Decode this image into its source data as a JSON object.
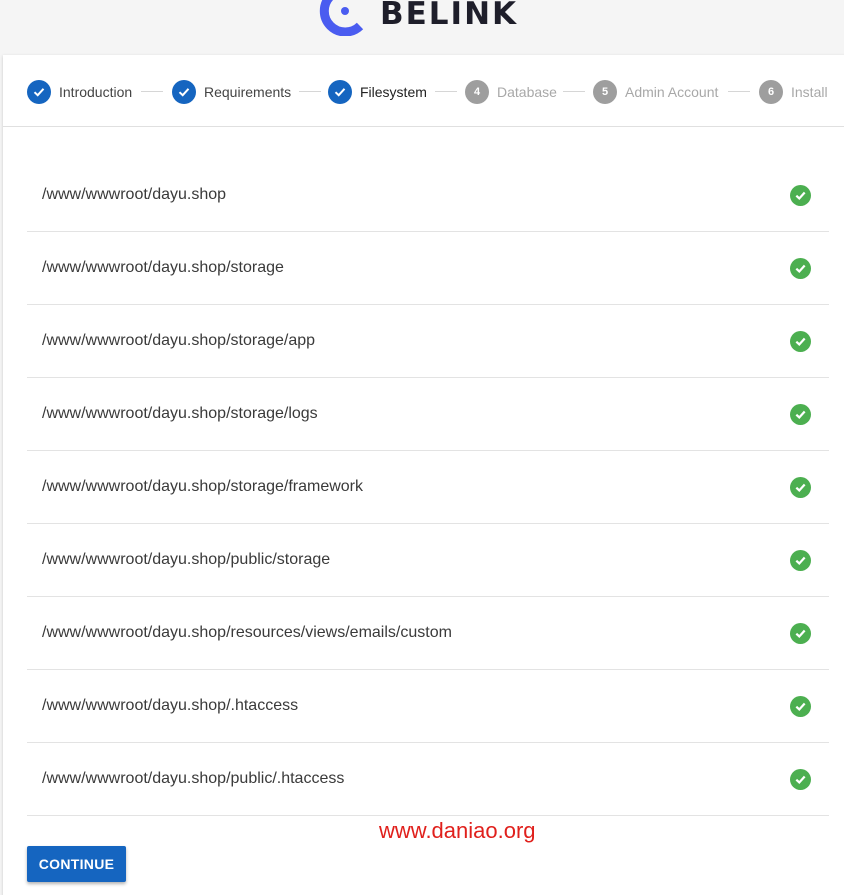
{
  "brand": {
    "name": "BELINK",
    "logo_icon": "belink-logo-icon",
    "accent": "#4a5cf0"
  },
  "stepper": {
    "steps": [
      {
        "label": "Introduction",
        "state": "done",
        "number": "1"
      },
      {
        "label": "Requirements",
        "state": "done",
        "number": "2"
      },
      {
        "label": "Filesystem",
        "state": "active",
        "number": "3"
      },
      {
        "label": "Database",
        "state": "todo",
        "number": "4"
      },
      {
        "label": "Admin Account",
        "state": "todo",
        "number": "5"
      },
      {
        "label": "Install",
        "state": "todo",
        "number": "6"
      }
    ],
    "done_color": "#1565c0",
    "todo_color": "#9e9e9e"
  },
  "filesystem": {
    "status_icon": "check-circle-icon",
    "status_color": "#4caf50",
    "paths": [
      "/www/wwwroot/dayu.shop",
      "/www/wwwroot/dayu.shop/storage",
      "/www/wwwroot/dayu.shop/storage/app",
      "/www/wwwroot/dayu.shop/storage/logs",
      "/www/wwwroot/dayu.shop/storage/framework",
      "/www/wwwroot/dayu.shop/public/storage",
      "/www/wwwroot/dayu.shop/resources/views/emails/custom",
      "/www/wwwroot/dayu.shop/.htaccess",
      "/www/wwwroot/dayu.shop/public/.htaccess"
    ]
  },
  "watermark": "www.daniao.org",
  "actions": {
    "continue_label": "CONTINUE"
  }
}
